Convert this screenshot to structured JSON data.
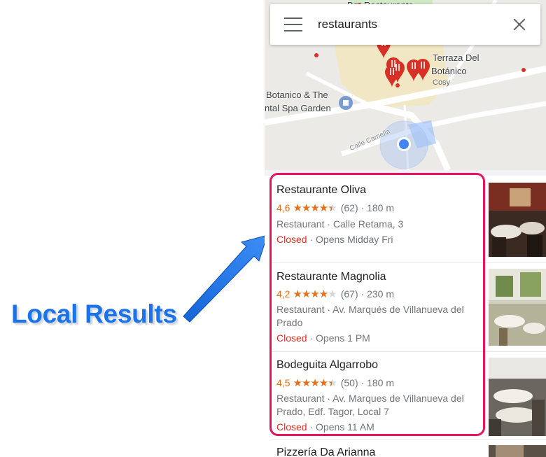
{
  "annotation": {
    "label": "Local Results",
    "color": "#1a73e8"
  },
  "search": {
    "query": "restaurants"
  },
  "map": {
    "labels": {
      "bar": "Bar Restaurante",
      "terraza_line1": "Terraza Del",
      "terraza_line2": "Botánico",
      "cosy": "Cosy",
      "botanico_line1": "Botanico & The",
      "botanico_line2": "ntal Spa Garden",
      "street": "Calle Camelia"
    }
  },
  "results": [
    {
      "name": "Restaurante Oliva",
      "rating": "4,6",
      "stars": 4.5,
      "reviews": "(62)",
      "distance": "· 180 m",
      "address": "Restaurant · Calle Retama, 3",
      "status": "Closed",
      "hours": " · Opens Midday Fri"
    },
    {
      "name": "Restaurante Magnolia",
      "rating": "4,2",
      "stars": 4,
      "reviews": "(67)",
      "distance": "· 230 m",
      "address": "Restaurant · Av. Marqués de Villanueva del Prado",
      "status": "Closed",
      "hours": " · Opens 1 PM"
    },
    {
      "name": "Bodeguita Algarrobo",
      "rating": "4,5",
      "stars": 4.5,
      "reviews": "(50)",
      "distance": "· 180 m",
      "address": "Restaurant · Av. Marques de Villanueva del Prado, Edf. Tagor, Local 7",
      "status": "Closed",
      "hours": " · Opens 11 AM"
    }
  ],
  "next_result": {
    "name": "Pizzería Da Arianna"
  },
  "colors": {
    "rating": "#e7711b",
    "closed": "#d93025",
    "highlight": "#e6135f",
    "pin": "#d93025",
    "location": "#4285f4"
  }
}
